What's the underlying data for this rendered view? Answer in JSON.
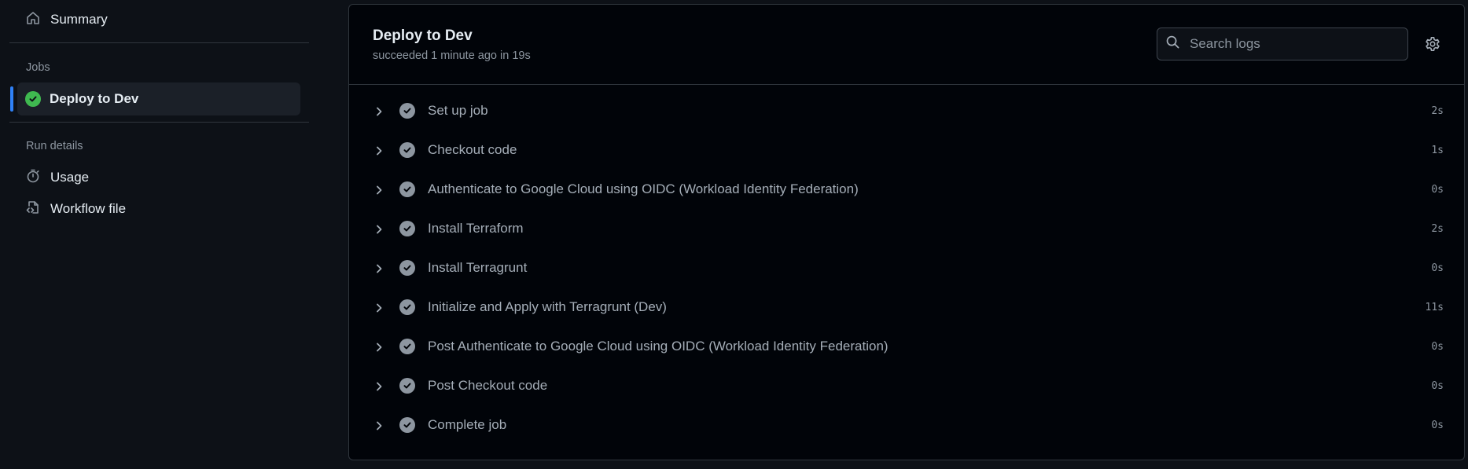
{
  "sidebar": {
    "summary_label": "Summary",
    "jobs_heading": "Jobs",
    "active_job": "Deploy to Dev",
    "run_details_heading": "Run details",
    "usage_label": "Usage",
    "workflow_file_label": "Workflow file"
  },
  "job": {
    "title": "Deploy to Dev",
    "status": "succeeded 1 minute ago in 19s"
  },
  "search": {
    "placeholder": "Search logs"
  },
  "steps": [
    {
      "name": "Set up job",
      "duration": "2s"
    },
    {
      "name": "Checkout code",
      "duration": "1s"
    },
    {
      "name": "Authenticate to Google Cloud using OIDC (Workload Identity Federation)",
      "duration": "0s"
    },
    {
      "name": "Install Terraform",
      "duration": "2s"
    },
    {
      "name": "Install Terragrunt",
      "duration": "0s"
    },
    {
      "name": "Initialize and Apply with Terragrunt (Dev)",
      "duration": "11s"
    },
    {
      "name": "Post Authenticate to Google Cloud using OIDC (Workload Identity Federation)",
      "duration": "0s"
    },
    {
      "name": "Post Checkout code",
      "duration": "0s"
    },
    {
      "name": "Complete job",
      "duration": "0s"
    }
  ],
  "colors": {
    "background": "#0d1117",
    "panel": "#010409",
    "success": "#3fb950",
    "accent": "#2f81f7"
  },
  "icons": {
    "summary": "home-icon",
    "job_status": "check-circle-icon",
    "usage": "stopwatch-icon",
    "workflow_file": "file-code-icon",
    "search": "search-icon",
    "settings": "gear-icon",
    "step_toggle": "chevron-right-icon",
    "step_status": "check-circle-icon"
  }
}
